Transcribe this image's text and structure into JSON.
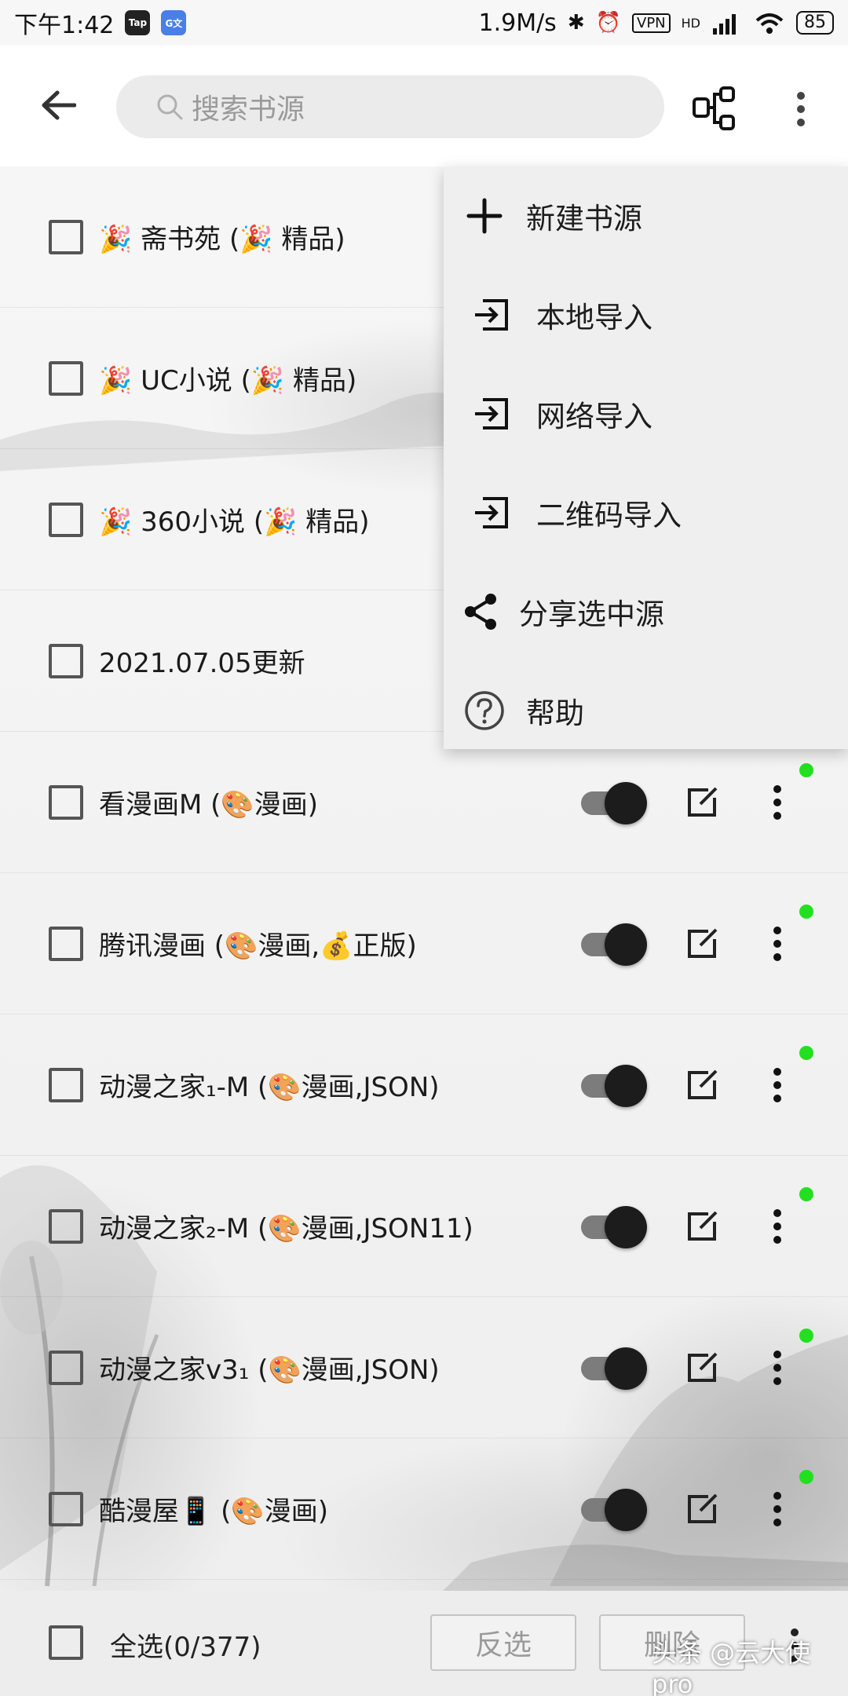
{
  "status_bar": {
    "time": "下午1:42",
    "app_badge_1": "Tap",
    "app_badge_2": "G文",
    "net_speed": "1.9M/s",
    "bluetooth_icon": "✱",
    "alarm_icon": "⏰",
    "vpn": "VPN",
    "hd": "HD",
    "battery": "85"
  },
  "header": {
    "search_placeholder": "搜索书源",
    "back_icon": "arrow-left",
    "qr_icon": "qr-code",
    "more_icon": "more-vertical"
  },
  "menu": {
    "items": [
      {
        "label": "新建书源",
        "icon": "plus"
      },
      {
        "label": "本地导入",
        "icon": "import"
      },
      {
        "label": "网络导入",
        "icon": "import"
      },
      {
        "label": "二维码导入",
        "icon": "import"
      },
      {
        "label": "分享选中源",
        "icon": "share"
      },
      {
        "label": "帮助",
        "icon": "help-circle"
      }
    ]
  },
  "list": {
    "rows": [
      {
        "label": "🎉 斋书苑 (🎉 精品)",
        "enabled": true,
        "dot": true
      },
      {
        "label": "🎉 UC小说 (🎉 精品)",
        "enabled": true,
        "dot": true
      },
      {
        "label": "🎉 360小说 (🎉 精品)",
        "enabled": true,
        "dot": true
      },
      {
        "label": "2021.07.05更新",
        "enabled": true,
        "dot": true
      },
      {
        "label": "看漫画M (🎨漫画)",
        "enabled": true,
        "dot": true
      },
      {
        "label": "腾讯漫画 (🎨漫画,💰正版)",
        "enabled": true,
        "dot": true
      },
      {
        "label": "动漫之家₁-M (🎨漫画,JSON)",
        "enabled": true,
        "dot": true
      },
      {
        "label": "动漫之家₂-M (🎨漫画,JSON11)",
        "enabled": true,
        "dot": true
      },
      {
        "label": "动漫之家v3₁ (🎨漫画,JSON)",
        "enabled": true,
        "dot": true
      },
      {
        "label": "酷漫屋📱 (🎨漫画)",
        "enabled": true,
        "dot": true
      }
    ]
  },
  "bottom_bar": {
    "select_all_label": "全选(0/377)",
    "invert_label": "反选",
    "delete_label": "删除"
  },
  "watermark": "头条 @云大使pro",
  "colors": {
    "status_dot": "#22e01f",
    "switch_thumb": "#1c1c1c",
    "switch_track": "#7c7c7c",
    "menu_bg": "#efefef"
  }
}
